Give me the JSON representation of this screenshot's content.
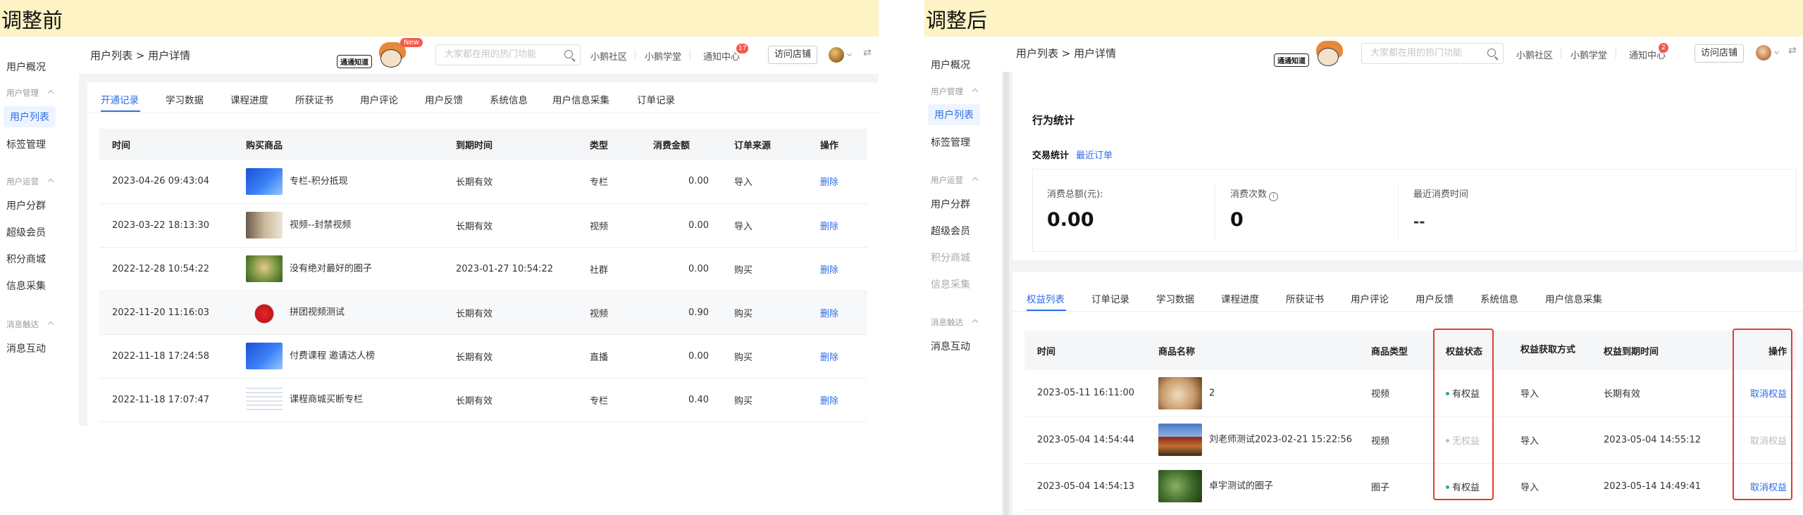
{
  "left": {
    "header_title": "调整前",
    "sidebar": {
      "items": [
        {
          "label": "用户概况"
        },
        {
          "group": "用户管理"
        },
        {
          "label": "用户列表",
          "active": true
        },
        {
          "label": "标签管理"
        },
        {
          "group": "用户运营"
        },
        {
          "label": "用户分群"
        },
        {
          "label": "超级会员"
        },
        {
          "label": "积分商城"
        },
        {
          "label": "信息采集"
        },
        {
          "group": "消息触达"
        },
        {
          "label": "消息互动"
        }
      ]
    },
    "breadcrumb": "用户列表 > 用户详情",
    "notice": {
      "label": "通通知道",
      "badge": "New"
    },
    "search_placeholder": "大家都在用的热门功能",
    "nav": {
      "community": "小鹅社区",
      "academy": "小鹅学堂",
      "notify": "通知中心",
      "notify_count": "17",
      "visit": "访问店铺"
    },
    "tabs": [
      "开通记录",
      "学习数据",
      "课程进度",
      "所获证书",
      "用户评论",
      "用户反馈",
      "系统信息",
      "用户信息采集",
      "订单记录"
    ],
    "table": {
      "headers": [
        "时间",
        "购买商品",
        "到期时间",
        "类型",
        "消费金额",
        "订单来源",
        "操作"
      ],
      "rows": [
        {
          "time": "2023-04-26 09:43:04",
          "product": "专栏-积分抵现",
          "expire": "长期有效",
          "type": "专栏",
          "amount": "0.00",
          "source": "导入",
          "action": "删除"
        },
        {
          "time": "2023-03-22 18:13:30",
          "product": "视频--封禁视频",
          "expire": "长期有效",
          "type": "视频",
          "amount": "0.00",
          "source": "导入",
          "action": "删除"
        },
        {
          "time": "2022-12-28 10:54:22",
          "product": "没有绝对最好的圈子",
          "expire": "2023-01-27 10:54:22",
          "type": "社群",
          "amount": "0.00",
          "source": "购买",
          "action": "删除"
        },
        {
          "time": "2022-11-20 11:16:03",
          "product": "拼团视频测试",
          "expire": "长期有效",
          "type": "视频",
          "amount": "0.90",
          "source": "购买",
          "action": "删除"
        },
        {
          "time": "2022-11-18 17:24:58",
          "product": "付费课程 邀请达人榜",
          "expire": "长期有效",
          "type": "直播",
          "amount": "0.00",
          "source": "购买",
          "action": "删除"
        },
        {
          "time": "2022-11-18 17:07:47",
          "product": "课程商城买断专栏",
          "expire": "长期有效",
          "type": "专栏",
          "amount": "0.40",
          "source": "购买",
          "action": "删除"
        }
      ]
    }
  },
  "right": {
    "header_title": "调整后",
    "sidebar": {
      "items": [
        {
          "label": "用户概况"
        },
        {
          "group": "用户管理"
        },
        {
          "label": "用户列表",
          "active": true
        },
        {
          "label": "标签管理"
        },
        {
          "group": "用户运营"
        },
        {
          "label": "用户分群"
        },
        {
          "label": "超级会员"
        },
        {
          "label": "积分商城",
          "disabled": true
        },
        {
          "label": "信息采集",
          "disabled": true
        },
        {
          "group": "消息触达"
        },
        {
          "label": "消息互动"
        }
      ]
    },
    "breadcrumb": "用户列表 > 用户详情",
    "notice": {
      "label": "通通知道"
    },
    "search_placeholder": "大家都在用的热门功能",
    "nav": {
      "community": "小鹅社区",
      "academy": "小鹅学堂",
      "notify": "通知中心",
      "notify_count": "2",
      "visit": "访问店铺"
    },
    "behavior_title": "行为统计",
    "trade_title": "交易统计",
    "recent_orders": "最近订单",
    "stats": [
      {
        "label": "消费总额(元):",
        "value": "0.00"
      },
      {
        "label": "消费次数",
        "value": "0"
      },
      {
        "label": "最近消费时间",
        "value": "--"
      }
    ],
    "tabs": [
      "权益列表",
      "订单记录",
      "学习数据",
      "课程进度",
      "所获证书",
      "用户评论",
      "用户反馈",
      "系统信息",
      "用户信息采集"
    ],
    "table": {
      "headers": [
        "时间",
        "商品名称",
        "商品类型",
        "权益状态",
        "权益获取方式",
        "权益到期时间",
        "操作"
      ],
      "rows": [
        {
          "time": "2023-05-11 16:11:00",
          "product": "2",
          "type": "视频",
          "status": "有权益",
          "status_active": true,
          "method": "导入",
          "expire": "长期有效",
          "action": "取消权益"
        },
        {
          "time": "2023-05-04 14:54:44",
          "product": "刘老师测试2023-02-21 15:22:56",
          "type": "视频",
          "status": "无权益",
          "status_active": false,
          "method": "导入",
          "expire": "2023-05-04 14:55:12",
          "action": "取消权益"
        },
        {
          "time": "2023-05-04 14:54:13",
          "product": "卓宇测试的圈子",
          "type": "圈子",
          "status": "有权益",
          "status_active": true,
          "method": "导入",
          "expire": "2023-05-14 14:49:41",
          "action": "取消权益"
        }
      ]
    }
  },
  "colors": {
    "accent": "#2c6de6",
    "highlight_box": "#e23b34",
    "header_band": "#fdf3c4",
    "status_active": "#2db46a",
    "status_inactive": "#bbbbbb"
  }
}
